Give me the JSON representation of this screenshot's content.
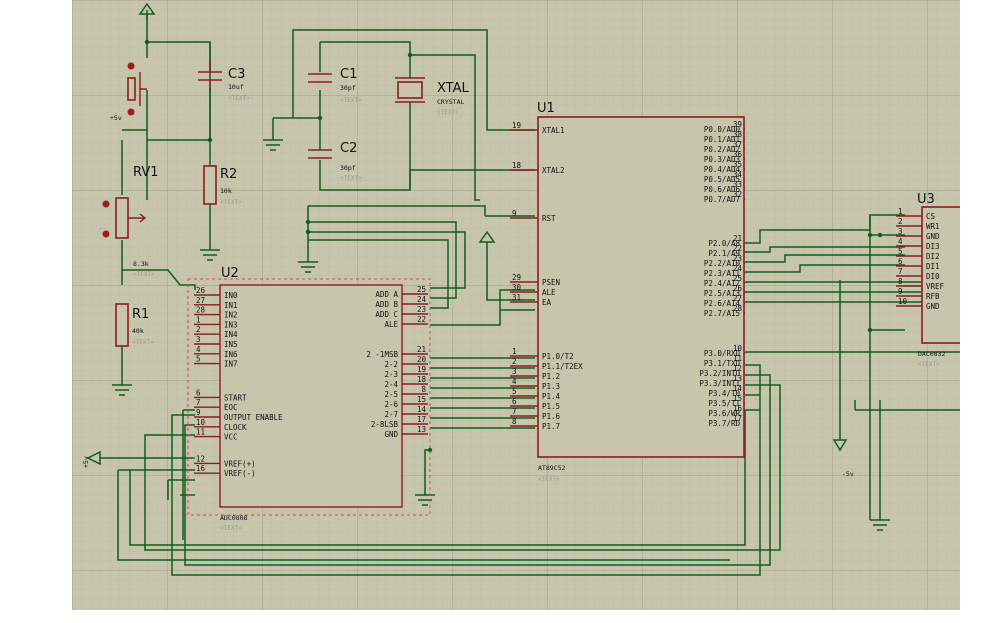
{
  "canvas": {
    "background": "#c8c5ad",
    "grid_minor": "#b9b69f",
    "grid_major": "#aaa78f",
    "wire_color": "#0d5e1d",
    "part_outline": "#8c1c1c"
  },
  "placeholder": "<TEXT>",
  "components": {
    "u1": {
      "ref": "U1",
      "part": "AT89C52",
      "left_pins": [
        {
          "num": "19",
          "name": "XTAL1"
        },
        {
          "num": "18",
          "name": "XTAL2"
        },
        {
          "num": "9",
          "name": "RST"
        },
        {
          "num": "29",
          "name": "PSEN"
        },
        {
          "num": "30",
          "name": "ALE"
        },
        {
          "num": "31",
          "name": "EA"
        },
        {
          "num": "1",
          "name": "P1.0/T2"
        },
        {
          "num": "2",
          "name": "P1.1/T2EX"
        },
        {
          "num": "3",
          "name": "P1.2"
        },
        {
          "num": "4",
          "name": "P1.3"
        },
        {
          "num": "5",
          "name": "P1.4"
        },
        {
          "num": "6",
          "name": "P1.5"
        },
        {
          "num": "7",
          "name": "P1.6"
        },
        {
          "num": "8",
          "name": "P1.7"
        }
      ],
      "right_pins": [
        {
          "num": "39",
          "name": "P0.0/AD0"
        },
        {
          "num": "38",
          "name": "P0.1/AD1"
        },
        {
          "num": "37",
          "name": "P0.2/AD2"
        },
        {
          "num": "36",
          "name": "P0.3/AD3"
        },
        {
          "num": "35",
          "name": "P0.4/AD4"
        },
        {
          "num": "34",
          "name": "P0.5/AD5"
        },
        {
          "num": "33",
          "name": "P0.6/AD6"
        },
        {
          "num": "32",
          "name": "P0.7/AD7"
        },
        {
          "num": "21",
          "name": "P2.0/A8"
        },
        {
          "num": "22",
          "name": "P2.1/A9"
        },
        {
          "num": "23",
          "name": "P2.2/A10"
        },
        {
          "num": "24",
          "name": "P2.3/A11"
        },
        {
          "num": "25",
          "name": "P2.4/A12"
        },
        {
          "num": "26",
          "name": "P2.5/A13"
        },
        {
          "num": "27",
          "name": "P2.6/A14"
        },
        {
          "num": "28",
          "name": "P2.7/A15"
        },
        {
          "num": "10",
          "name": "P3.0/RXD"
        },
        {
          "num": "11",
          "name": "P3.1/TXD"
        },
        {
          "num": "12",
          "name": "P3.2/INTO"
        },
        {
          "num": "13",
          "name": "P3.3/INT1"
        },
        {
          "num": "14",
          "name": "P3.4/T0"
        },
        {
          "num": "15",
          "name": "P3.5/T1"
        },
        {
          "num": "16",
          "name": "P3.6/WR"
        },
        {
          "num": "17",
          "name": "P3.7/RD"
        }
      ]
    },
    "u2": {
      "ref": "U2",
      "part": "ADC0808",
      "left_pins": [
        {
          "num": "26",
          "name": "IN0"
        },
        {
          "num": "27",
          "name": "IN1"
        },
        {
          "num": "28",
          "name": "IN2"
        },
        {
          "num": "1",
          "name": "IN3"
        },
        {
          "num": "2",
          "name": "IN4"
        },
        {
          "num": "3",
          "name": "IN5"
        },
        {
          "num": "4",
          "name": "IN6"
        },
        {
          "num": "5",
          "name": "IN7"
        },
        {
          "num": "6",
          "name": "START"
        },
        {
          "num": "7",
          "name": "EOC"
        },
        {
          "num": "9",
          "name": "OUTPUT ENABLE"
        },
        {
          "num": "10",
          "name": "CLOCK"
        },
        {
          "num": "11",
          "name": "VCC"
        },
        {
          "num": "12",
          "name": "VREF(+)"
        },
        {
          "num": "16",
          "name": "VREF(-)"
        }
      ],
      "right_pins": [
        {
          "num": "25",
          "name": "ADD A"
        },
        {
          "num": "24",
          "name": "ADD B"
        },
        {
          "num": "23",
          "name": "ADD C"
        },
        {
          "num": "22",
          "name": "ALE"
        },
        {
          "num": "21",
          "name": "2 -1MSB"
        },
        {
          "num": "20",
          "name": "2-2"
        },
        {
          "num": "19",
          "name": "2-3"
        },
        {
          "num": "18",
          "name": "2-4"
        },
        {
          "num": "8",
          "name": "2-5"
        },
        {
          "num": "15",
          "name": "2-6"
        },
        {
          "num": "14",
          "name": "2-7"
        },
        {
          "num": "17",
          "name": "2-8LSB"
        },
        {
          "num": "13",
          "name": "GND"
        }
      ]
    },
    "u3": {
      "ref": "U3",
      "part": "DAC0832",
      "pins": [
        {
          "num": "1",
          "name": "CS"
        },
        {
          "num": "2",
          "name": "WR1"
        },
        {
          "num": "3",
          "name": "GND"
        },
        {
          "num": "4",
          "name": "DI3"
        },
        {
          "num": "5",
          "name": "DI2"
        },
        {
          "num": "6",
          "name": "DI1"
        },
        {
          "num": "7",
          "name": "DI0"
        },
        {
          "num": "8",
          "name": "VREF"
        },
        {
          "num": "9",
          "name": "RFB"
        },
        {
          "num": "10",
          "name": "GND"
        }
      ]
    },
    "c1": {
      "ref": "C1",
      "value": "30pf"
    },
    "c2": {
      "ref": "C2",
      "value": "30pf"
    },
    "c3": {
      "ref": "C3",
      "value": "10uf"
    },
    "xtal": {
      "ref": "XTAL",
      "value": "CRYSTAL"
    },
    "r1": {
      "ref": "R1",
      "value": "40k"
    },
    "r2": {
      "ref": "R2",
      "value": "10k"
    },
    "rv1": {
      "ref": "RV1",
      "value": "8.3k"
    }
  },
  "supply_labels": {
    "plus5v_top": "+5v",
    "plus5v_left": "+5v",
    "minus5v": "-5v"
  }
}
